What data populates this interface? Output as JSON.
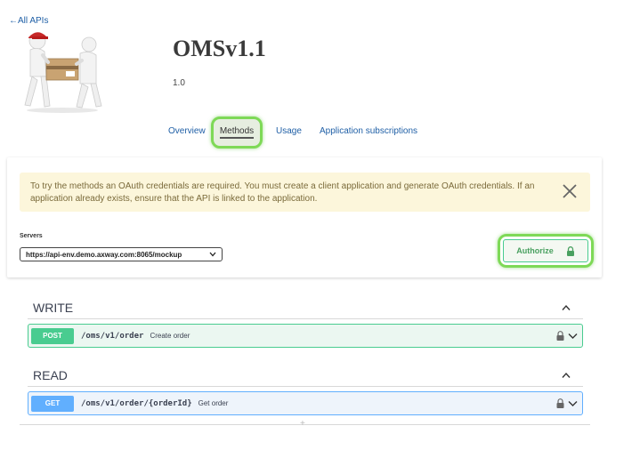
{
  "nav": {
    "back_label": "←All APIs"
  },
  "api": {
    "title": "OMSv1.1",
    "version": "1.0"
  },
  "tabs": [
    {
      "label": "Overview"
    },
    {
      "label": "Methods",
      "active": true
    },
    {
      "label": "Usage"
    },
    {
      "label": "Application subscriptions"
    }
  ],
  "notice": {
    "text": "To try the methods an OAuth credentials are required. You must create a client application and generate OAuth credentials. If an application already exists, ensure that the API is linked to the application."
  },
  "servers": {
    "label": "Servers",
    "selected": "https://api-env.demo.axway.com:8065/mockup"
  },
  "authorize": {
    "label": "Authorize"
  },
  "sections": [
    {
      "name": "WRITE",
      "operations": [
        {
          "method": "POST",
          "path": "/oms/v1/order",
          "summary": "Create order"
        }
      ]
    },
    {
      "name": "READ",
      "operations": [
        {
          "method": "GET",
          "path": "/oms/v1/order/{orderId}",
          "summary": "Get order"
        }
      ]
    }
  ],
  "colors": {
    "link": "#1f5fa6",
    "highlight": "#7ed957",
    "post": "#49cc90",
    "get": "#61affe",
    "notice_bg": "#fcf6db"
  },
  "icons": {
    "close": "close-icon",
    "lock": "lock-icon",
    "caret_up": "chevron-up-icon",
    "caret_down": "chevron-down-icon"
  }
}
